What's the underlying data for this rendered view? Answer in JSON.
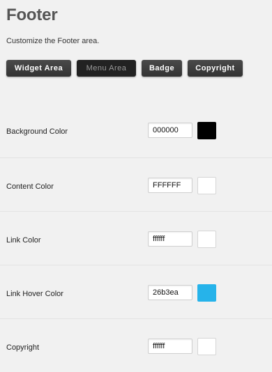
{
  "page": {
    "title": "Footer",
    "subtitle": "Customize the Footer area."
  },
  "tabs": [
    {
      "label": "Widget Area",
      "active": false
    },
    {
      "label": "Menu Area",
      "active": true
    },
    {
      "label": "Badge",
      "active": false
    },
    {
      "label": "Copyright",
      "active": false
    }
  ],
  "settings": [
    {
      "label": "Background Color",
      "value": "000000",
      "swatch": "#000000"
    },
    {
      "label": "Content Color",
      "value": "FFFFFF",
      "swatch": "#FFFFFF"
    },
    {
      "label": "Link Color",
      "value": "ffffff",
      "swatch": "#ffffff"
    },
    {
      "label": "Link Hover Color",
      "value": "26b3ea",
      "swatch": "#26b3ea"
    },
    {
      "label": "Copyright",
      "value": "ffffff",
      "swatch": "#ffffff"
    }
  ]
}
